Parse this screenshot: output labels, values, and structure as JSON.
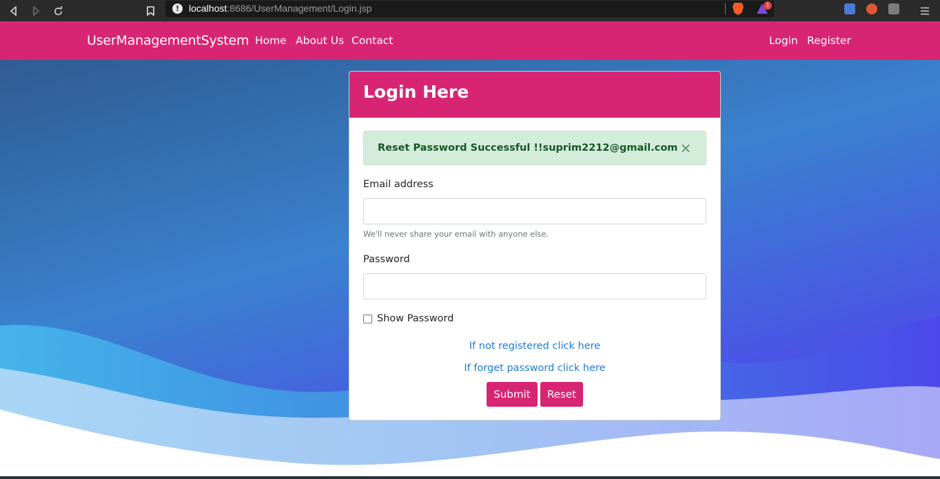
{
  "browser": {
    "url_host": "localhost",
    "url_rest": ":8686/UserManagement/Login.jsp",
    "rewards_badge": "1",
    "icons": [
      "back-icon",
      "forward-icon",
      "reload-icon",
      "bookmark-icon",
      "site-info-icon",
      "brave-shields-icon",
      "brave-rewards-icon",
      "translate-extension-icon",
      "duckduckgo-extension-icon",
      "extensions-icon",
      "menu-icon"
    ]
  },
  "navbar": {
    "brand": "UserManagementSystem",
    "links": [
      "Home",
      "About Us",
      "Contact"
    ],
    "right_links": [
      "Login",
      "Register"
    ],
    "color": "#d72573"
  },
  "card": {
    "title": "Login Here",
    "alert": {
      "message": "Reset Password Successful !!suprim2212@gmail.com",
      "close_symbol": "×"
    },
    "email": {
      "label": "Email address",
      "value": "",
      "help": "We'll never share your email with anyone else."
    },
    "password": {
      "label": "Password",
      "value": ""
    },
    "show_password": {
      "label": "Show Password",
      "checked": false
    },
    "links": {
      "register": "If not registered click here",
      "forgot": "If forget password click here"
    },
    "buttons": {
      "submit": "Submit",
      "reset": "Reset"
    }
  }
}
